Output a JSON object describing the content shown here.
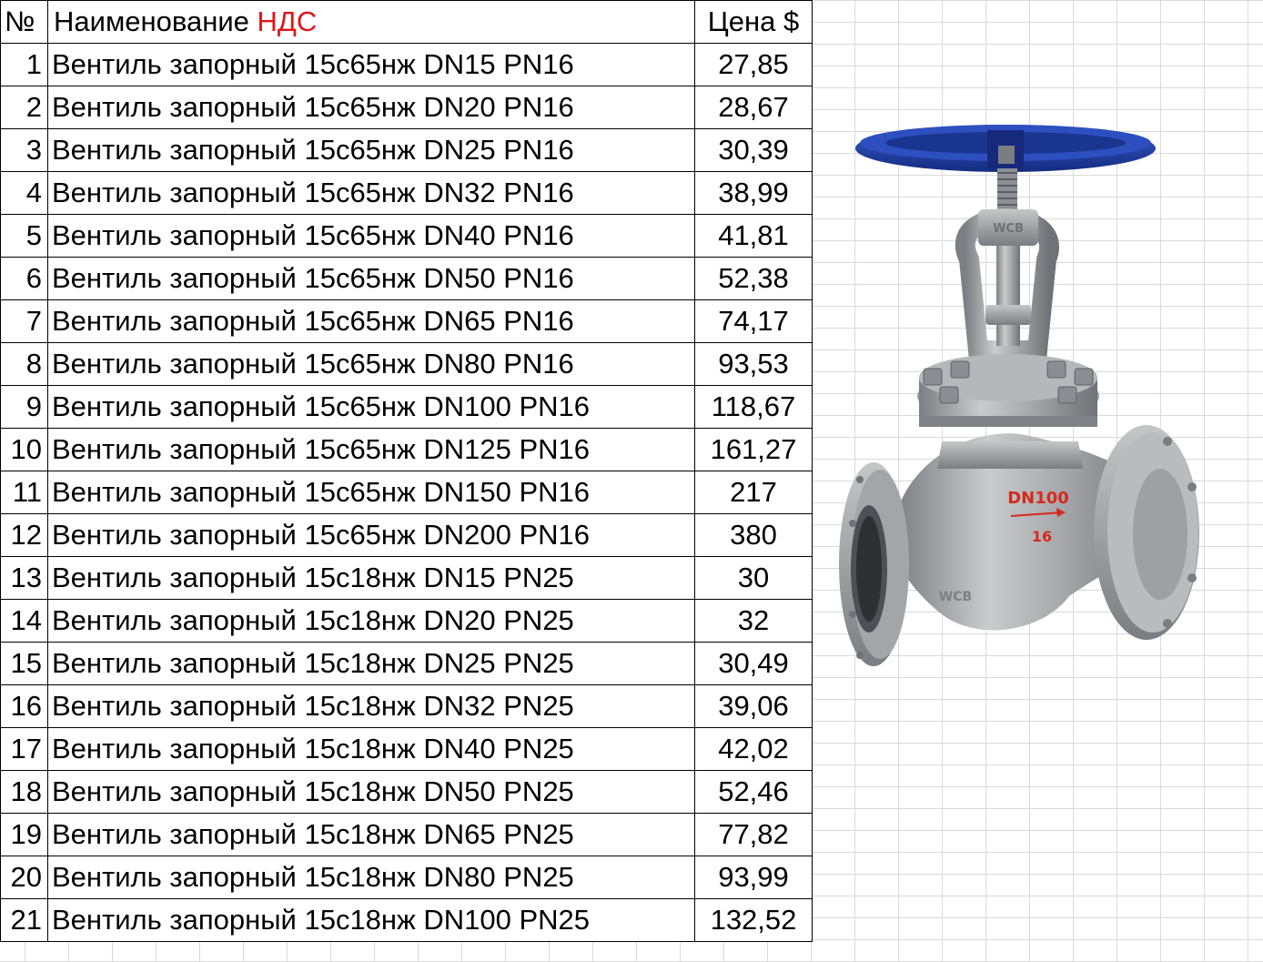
{
  "table": {
    "headers": {
      "number": "№",
      "name": "Наименование",
      "vat": "НДС",
      "price": "Цена $"
    },
    "rows": [
      {
        "num": "1",
        "name": "Вентиль запорный 15с65нж DN15 PN16",
        "price": "27,85"
      },
      {
        "num": "2",
        "name": "Вентиль запорный 15с65нж DN20 PN16",
        "price": "28,67"
      },
      {
        "num": "3",
        "name": "Вентиль запорный 15с65нж DN25 PN16",
        "price": "30,39"
      },
      {
        "num": "4",
        "name": "Вентиль запорный 15с65нж DN32 PN16",
        "price": "38,99"
      },
      {
        "num": "5",
        "name": "Вентиль запорный 15с65нж DN40 PN16",
        "price": "41,81"
      },
      {
        "num": "6",
        "name": "Вентиль запорный 15с65нж DN50 PN16",
        "price": "52,38"
      },
      {
        "num": "7",
        "name": "Вентиль запорный 15с65нж DN65 PN16",
        "price": "74,17"
      },
      {
        "num": "8",
        "name": "Вентиль запорный 15с65нж DN80 PN16",
        "price": "93,53"
      },
      {
        "num": "9",
        "name": "Вентиль запорный 15с65нж DN100 PN16",
        "price": "118,67"
      },
      {
        "num": "10",
        "name": "Вентиль запорный 15с65нж DN125 PN16",
        "price": "161,27"
      },
      {
        "num": "11",
        "name": "Вентиль запорный 15с65нж DN150 PN16",
        "price": "217"
      },
      {
        "num": "12",
        "name": "Вентиль запорный 15с65нж DN200 PN16",
        "price": "380"
      },
      {
        "num": "13",
        "name": "Вентиль запорный 15с18нж DN15 PN25",
        "price": "30"
      },
      {
        "num": "14",
        "name": "Вентиль запорный 15с18нж DN20 PN25",
        "price": "32"
      },
      {
        "num": "15",
        "name": "Вентиль запорный 15с18нж DN25 PN25",
        "price": "30,49"
      },
      {
        "num": "16",
        "name": "Вентиль запорный 15с18нж DN32 PN25",
        "price": "39,06"
      },
      {
        "num": "17",
        "name": "Вентиль запорный 15с18нж DN40 PN25",
        "price": "42,02"
      },
      {
        "num": "18",
        "name": "Вентиль запорный 15с18нж DN50 PN25",
        "price": "52,46"
      },
      {
        "num": "19",
        "name": "Вентиль запорный 15с18нж DN65 PN25",
        "price": "77,82"
      },
      {
        "num": "20",
        "name": "Вентиль запорный 15с18нж DN80 PN25",
        "price": "93,99"
      },
      {
        "num": "21",
        "name": "Вентиль запорный 15с18нж DN100 PN25",
        "price": "132,52"
      }
    ]
  },
  "product_image": {
    "body_marking": "DN100",
    "pressure_marking": "16",
    "material_marking": "WCB",
    "colors": {
      "handwheel": "#1f3fa8",
      "body": "#a6a8ab",
      "marking": "#d42a1c"
    }
  },
  "colors": {
    "vat_label": "#e0151b",
    "grid_line": "#d9d9d9",
    "border": "#000000"
  }
}
